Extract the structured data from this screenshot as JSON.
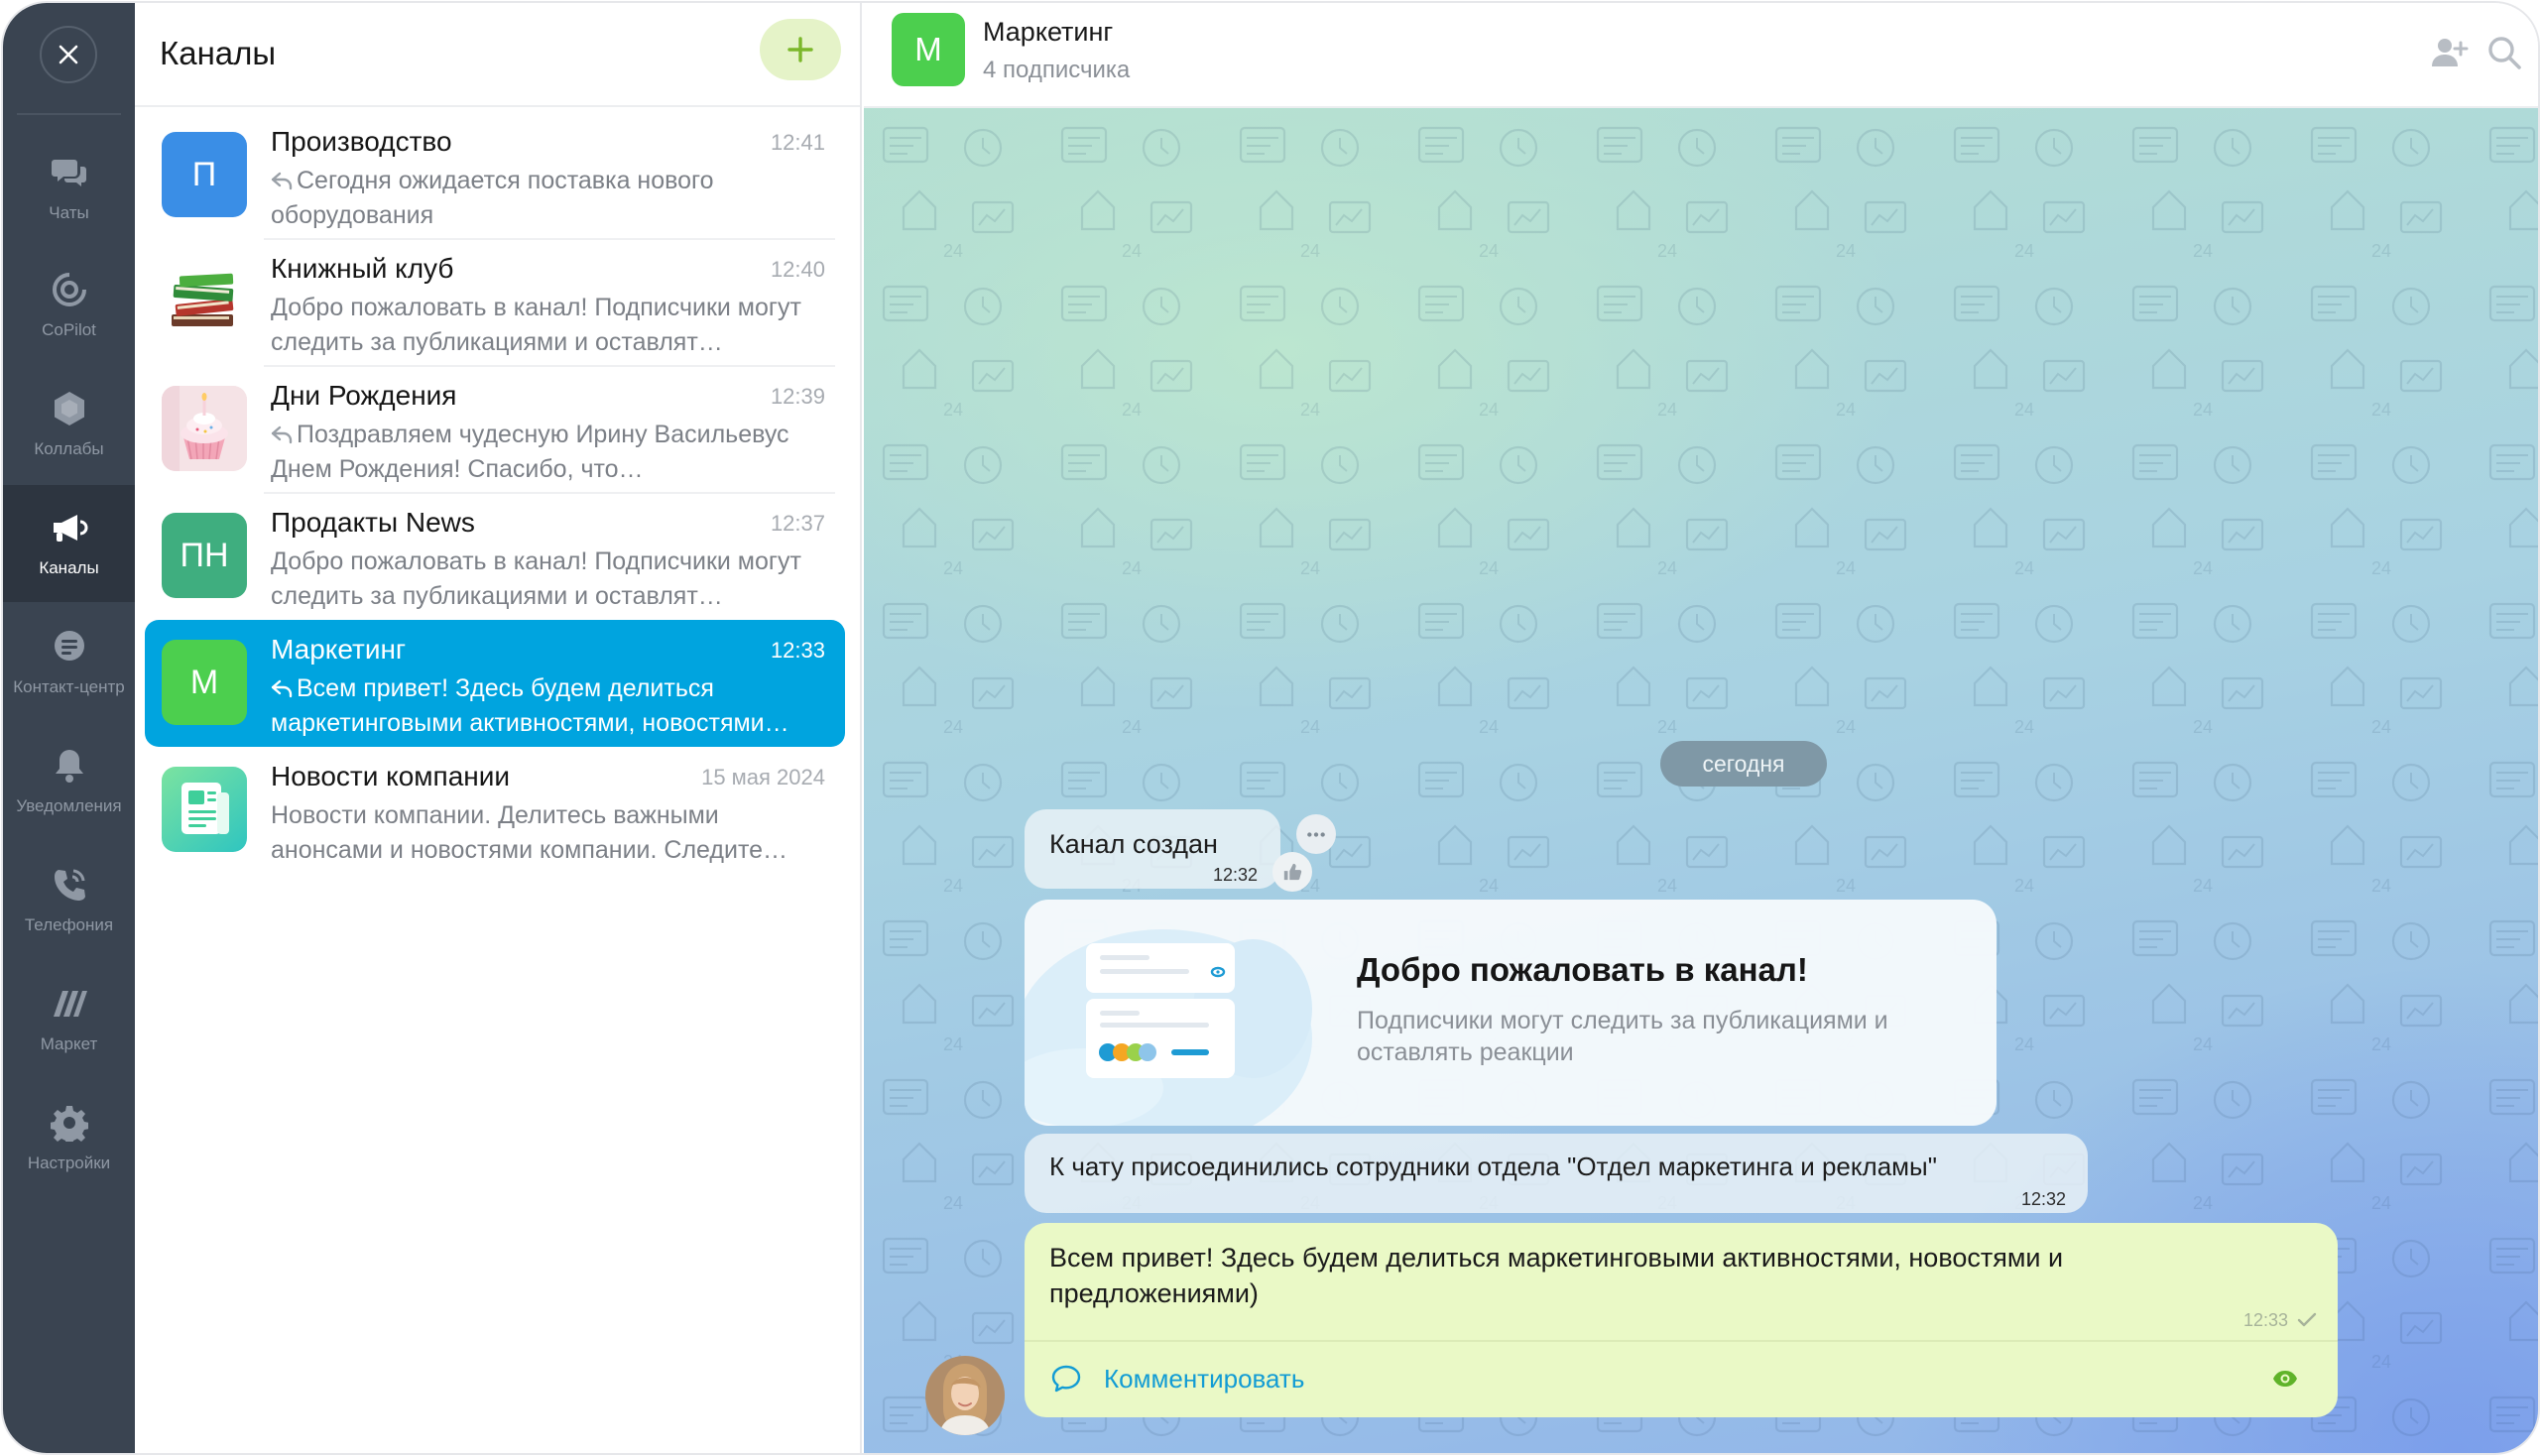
{
  "rail": {
    "items": [
      {
        "label": "Чаты",
        "icon": "chats-icon"
      },
      {
        "label": "CoPilot",
        "icon": "copilot-icon"
      },
      {
        "label": "Коллабы",
        "icon": "collabs-icon"
      },
      {
        "label": "Каналы",
        "icon": "channels-icon",
        "active": true
      },
      {
        "label": "Контакт-центр",
        "icon": "contact-center-icon"
      },
      {
        "label": "Уведомления",
        "icon": "bell-icon"
      },
      {
        "label": "Телефония",
        "icon": "phone-icon"
      },
      {
        "label": "Маркет",
        "icon": "market-icon"
      },
      {
        "label": "Настройки",
        "icon": "gear-icon"
      }
    ]
  },
  "list": {
    "title": "Каналы",
    "channels": [
      {
        "name": "Производство",
        "time": "12:41",
        "avatar_text": "П",
        "avatar_color": "#3a8ee6",
        "reply": true,
        "preview": "Сегодня ожидается поставка нового оборудования"
      },
      {
        "name": "Книжный клуб",
        "time": "12:40",
        "avatar_text": "",
        "avatar_image": "books-icon",
        "reply": false,
        "preview": "Добро пожаловать в канал! Подписчики могут следить за публикациями и оставлят…"
      },
      {
        "name": "Дни Рождения",
        "time": "12:39",
        "avatar_text": "",
        "avatar_image": "cupcake-icon",
        "reply": true,
        "preview": "Поздравляем чудесную Ирину Васильевус Днем Рождения! Спасибо, что…"
      },
      {
        "name": "Продакты News",
        "time": "12:37",
        "avatar_text": "ПН",
        "avatar_color": "#3fae7f",
        "reply": false,
        "preview": "Добро пожаловать в канал! Подписчики могут следить за публикациями и оставлят…"
      },
      {
        "name": "Маркетинг",
        "time": "12:33",
        "avatar_text": "М",
        "avatar_color": "#4ccf4e",
        "reply": true,
        "active": true,
        "preview": "Всем привет! Здесь будем делиться маркетинговыми активностями, новостями…"
      },
      {
        "name": "Новости компании",
        "time": "15 мая 2024",
        "avatar_text": "",
        "avatar_image": "newspaper-icon",
        "reply": false,
        "preview": "Новости компании. Делитесь важными анонсами и новостями компании. Следите…"
      }
    ]
  },
  "chat": {
    "avatar_text": "М",
    "title": "Маркетинг",
    "subtitle": "4 подписчика",
    "date_pill": "сегодня",
    "created": {
      "text": "Канал создан",
      "time": "12:32"
    },
    "welcome": {
      "title": "Добро пожаловать в канал!",
      "text": "Подписчики могут следить за публикациями и оставлять реакции"
    },
    "joined": {
      "text": "К чату присоединились сотрудники отдела \"Отдел маркетинга и рекламы\"",
      "time": "12:32"
    },
    "post": {
      "text": "Всем привет! Здесь будем делиться маркетинговыми активностями, новостями и предложениями)",
      "time": "12:33",
      "comment_label": "Комментировать"
    }
  },
  "colors": {
    "accent": "#00a4df",
    "rail_bg": "#3a4451",
    "add_btn": "#e5f3c8",
    "post_bg": "#eaf9c6"
  }
}
